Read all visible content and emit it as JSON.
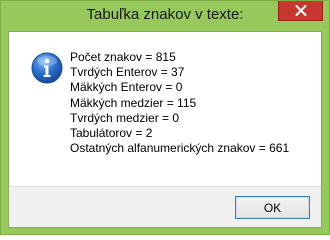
{
  "window": {
    "title": "Tabuľka znakov v texte:",
    "accent_color": "#96c85b",
    "close_icon": "close-icon"
  },
  "message": {
    "icon": "info-icon",
    "lines": [
      "Počet znakov = 815",
      "Tvrdých Enterov = 37",
      "Mäkkých Enterov = 0",
      "Mäkkých medzier = 115",
      "Tvrdých medzier = 0",
      "Tabulátorov = 2",
      "Ostatných alfanumerických znakov = 661"
    ]
  },
  "buttons": {
    "ok_label": "OK"
  }
}
